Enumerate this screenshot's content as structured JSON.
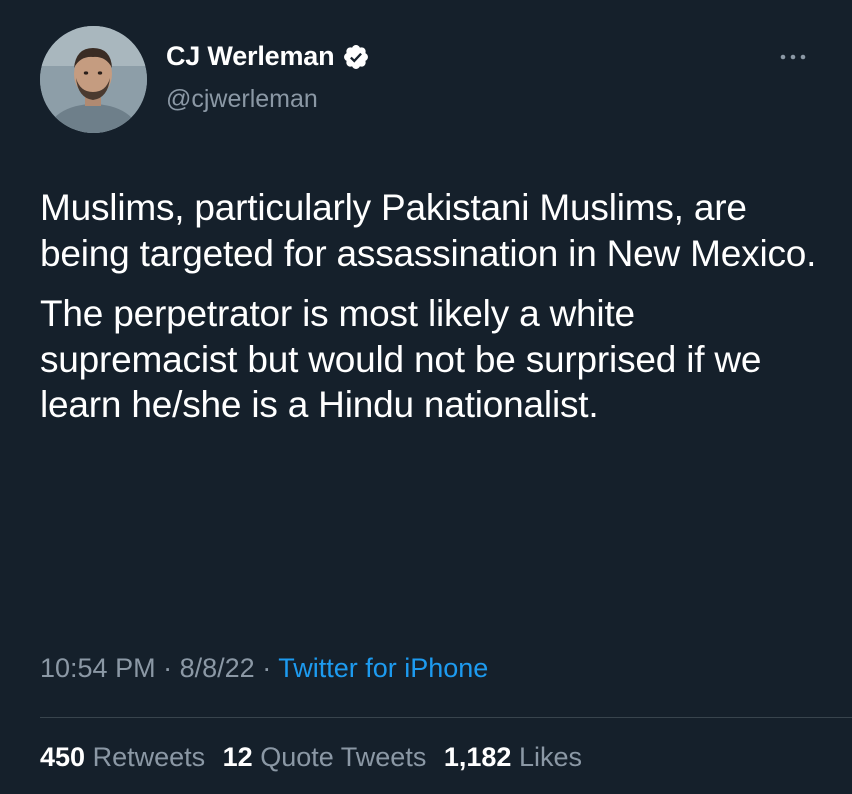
{
  "author": {
    "display_name": "CJ Werleman",
    "handle": "@cjwerleman",
    "verified": true,
    "avatar_icon": "profile-photo"
  },
  "tweet": {
    "paragraphs": [
      "Muslims, particularly Pakistani Muslims, are being targeted for assassination in New Mexico.",
      "The perpetrator is most likely a white supremacist but would not be surprised if we learn he/she is a Hindu nationalist."
    ],
    "time": "10:54 PM",
    "date": "8/8/22",
    "separator": "·",
    "source": "Twitter for iPhone"
  },
  "stats": {
    "retweets_count": "450",
    "retweets_label": "Retweets",
    "quotes_count": "12",
    "quotes_label": "Quote Tweets",
    "likes_count": "1,182",
    "likes_label": "Likes"
  },
  "colors": {
    "background": "#15202b",
    "text": "#ffffff",
    "secondary": "#8b98a5",
    "link": "#1d9bf0",
    "divider": "#38444d"
  },
  "icons": {
    "more": "more-horizontal-icon",
    "verified": "verified-badge-icon"
  }
}
